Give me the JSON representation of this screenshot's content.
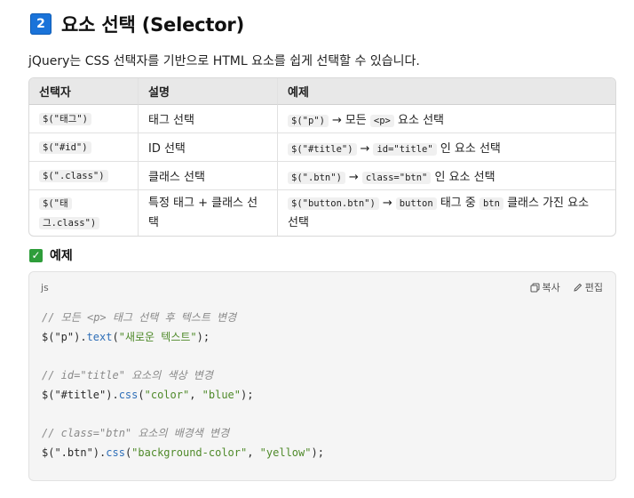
{
  "section": {
    "number": "2",
    "title": "요소 선택 (Selector)"
  },
  "intro": "jQuery는 CSS 선택자를 기반으로 HTML 요소를 쉽게 선택할 수 있습니다.",
  "table": {
    "headers": [
      "선택자",
      "설명",
      "예제"
    ],
    "rows": [
      {
        "selector": "$(\"태그\")",
        "desc": "태그 선택",
        "ex_code": "$(\"p\")",
        "ex_arrow": "→",
        "ex_text1": "모든",
        "ex_code2": "<p>",
        "ex_text2": "요소 선택"
      },
      {
        "selector": "$(\"#id\")",
        "desc": "ID 선택",
        "ex_code": "$(\"#title\")",
        "ex_arrow": "→",
        "ex_code2": "id=\"title\"",
        "ex_text2": "인 요소 선택"
      },
      {
        "selector": "$(\".class\")",
        "desc": "클래스 선택",
        "ex_code": "$(\".btn\")",
        "ex_arrow": "→",
        "ex_code2": "class=\"btn\"",
        "ex_text2": "인 요소 선택"
      },
      {
        "selector_a": "$(\"태",
        "selector_b": "그.class\")",
        "desc_a": "특정 태그 + 클래스 선",
        "desc_b": "택",
        "ex_code": "$(\"button.btn\")",
        "ex_arrow": "→",
        "ex_code2": "button",
        "ex_text1": "태그 중",
        "ex_code3": "btn",
        "ex_text2": "클래스 가진 요소",
        "ex_text3": "선택"
      }
    ]
  },
  "example": {
    "heading": "예제",
    "check_icon": "check-box-icon",
    "code": {
      "language": "js",
      "copy_label": "복사",
      "edit_label": "편집",
      "lines": [
        {
          "comment": "// 모든 <p> 태그 선택 후 텍스트 변경"
        },
        {
          "obj": "$(\"p\").",
          "fn": "text",
          "open": "(",
          "arg1": "\"새로운 텍스트\"",
          "close": ");"
        },
        {
          "comment": "// id=\"title\" 요소의 색상 변경"
        },
        {
          "obj": "$(\"#title\").",
          "fn": "css",
          "open": "(",
          "arg1": "\"color\"",
          "sep": ", ",
          "arg2": "\"blue\"",
          "close": ");"
        },
        {
          "comment": "// class=\"btn\" 요소의 배경색 변경"
        },
        {
          "obj": "$(\".btn\").",
          "fn": "css",
          "open": "(",
          "arg1": "\"background-color\"",
          "sep": ", ",
          "arg2": "\"yellow\"",
          "close": ");"
        }
      ]
    }
  },
  "colors": {
    "badge": "#1a73d9",
    "check": "#2e9d3a",
    "code_fn": "#2f6fb8",
    "code_string": "#4f8a2a",
    "code_comment": "#8a8a8a"
  }
}
